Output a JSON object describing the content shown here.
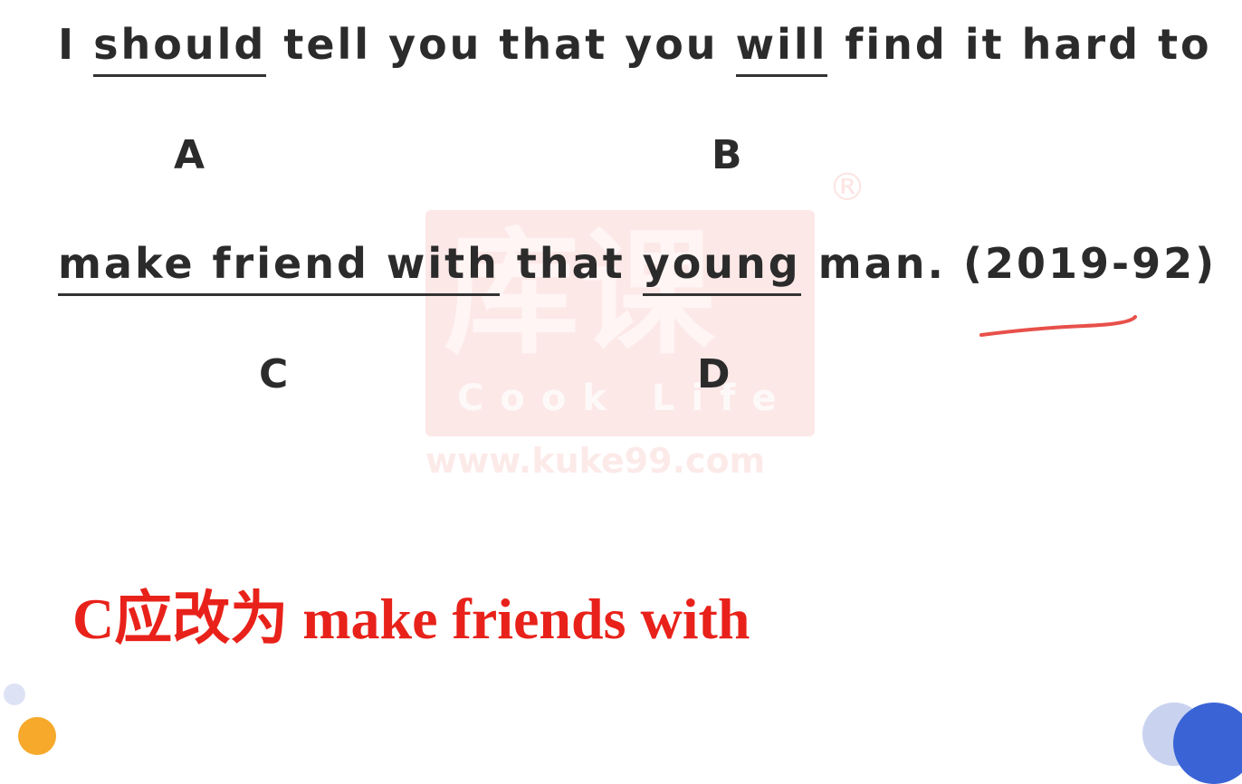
{
  "question": {
    "line1": {
      "seg1": "I ",
      "opt_a": "should",
      "seg2": " tell you that you ",
      "opt_b": "will",
      "seg3": " find it hard to"
    },
    "line2": {
      "opt_c": "make friend with",
      "seg1": " that ",
      "opt_d": "young",
      "seg2": " man. (2019-92)"
    },
    "labels": {
      "a": "A",
      "b": "B",
      "c": "C",
      "d": "D"
    }
  },
  "answer": "C应改为 make friends with",
  "watermark": {
    "main": "库课",
    "sub": "Cook Life",
    "url": "www.kuke99.com",
    "reg": "®"
  },
  "colors": {
    "text": "#2b2b2b",
    "answer_red": "#e8221a",
    "annotation_red": "#e8504a"
  }
}
